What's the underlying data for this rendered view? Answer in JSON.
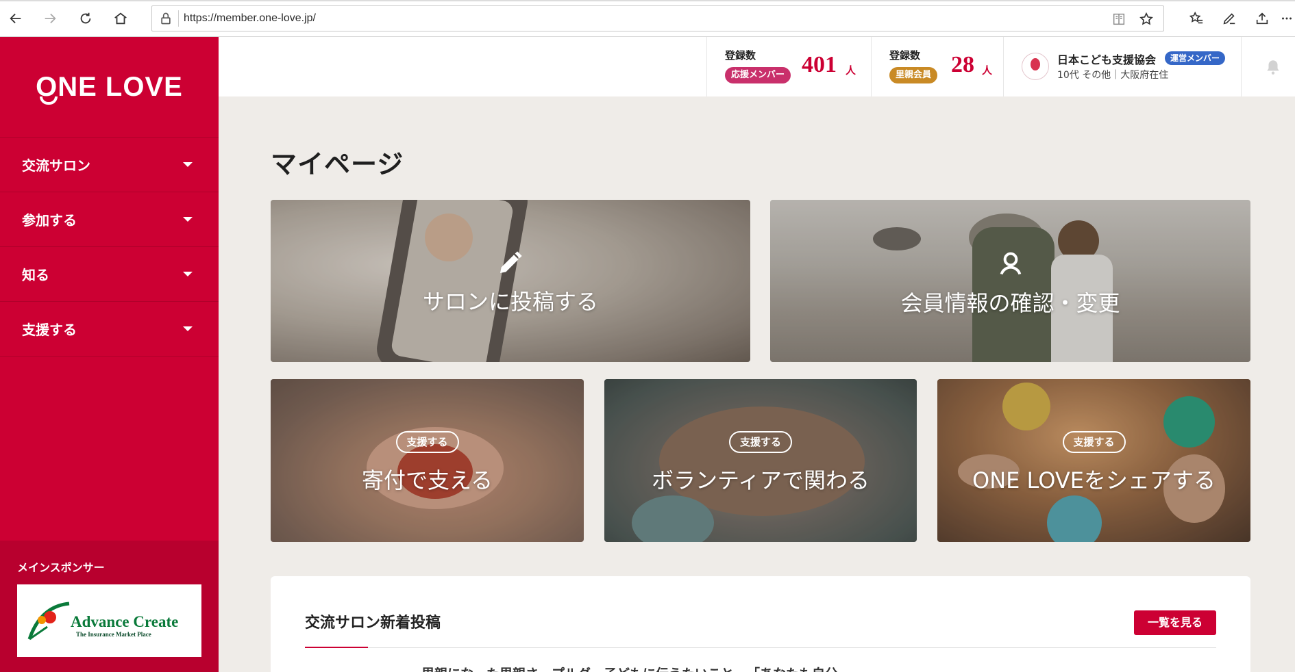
{
  "browser": {
    "url": "https://member.one-love.jp/"
  },
  "sidebar": {
    "logo": "ONE LOVE",
    "items": [
      {
        "label": "交流サロン"
      },
      {
        "label": "参加する"
      },
      {
        "label": "知る"
      },
      {
        "label": "支援する"
      }
    ],
    "sponsor_label": "メインスポンサー",
    "sponsor_name": "Advance Create",
    "sponsor_tagline": "The Insurance Market Place"
  },
  "header": {
    "stats": [
      {
        "label": "登録数",
        "badge": "応援メンバー",
        "badge_color": "#c9306b",
        "value": "401",
        "unit": "人"
      },
      {
        "label": "登録数",
        "badge": "里親会員",
        "badge_color": "#c98a25",
        "value": "28",
        "unit": "人"
      }
    ],
    "org": {
      "name": "日本こども支援協会",
      "badge": "運営メンバー",
      "sub": "10代 その他｜大阪府在住"
    }
  },
  "main": {
    "title": "マイページ",
    "cards": [
      {
        "title": "サロンに投稿する",
        "icon": "pencil-icon"
      },
      {
        "title": "会員情報の確認・変更",
        "icon": "user-icon"
      },
      {
        "tag": "支援する",
        "title": "寄付で支える"
      },
      {
        "tag": "支援する",
        "title": "ボランティアで関わる"
      },
      {
        "tag": "支援する",
        "title": "ONE LOVEをシェアする"
      }
    ]
  },
  "posts": {
    "title": "交流サロン新着投稿",
    "button": "一覧を見る",
    "first_row": "里親にな…た里親さ…プルグ…子どもに伝うたいこと…「あなたも自分"
  },
  "colors": {
    "brand": "#cc0033",
    "background": "#efece8"
  }
}
